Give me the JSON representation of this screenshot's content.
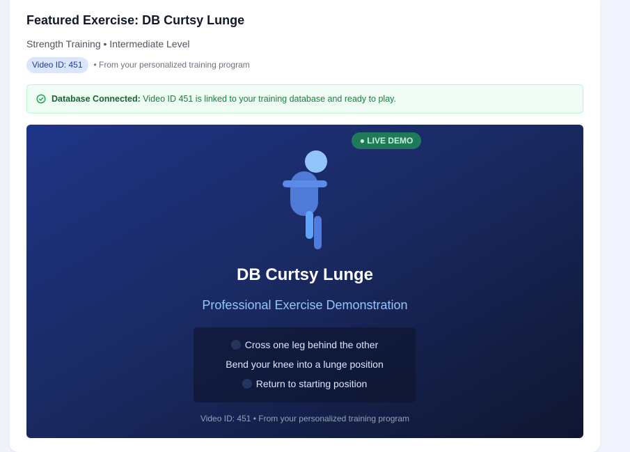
{
  "header": {
    "title": "Featured Exercise: DB Curtsy Lunge",
    "subtitle": "Strength Training • Intermediate Level",
    "video_badge": "Video ID: 451",
    "source_note": "• From your personalized training program"
  },
  "alert": {
    "icon": "check-circle-icon",
    "strong": "Database Connected:",
    "text": " Video ID 451 is linked to your training database and ready to play."
  },
  "player": {
    "live_badge": "● LIVE DEMO",
    "exercise_title": "DB Curtsy Lunge",
    "exercise_subtitle": "Professional Exercise Demonstration",
    "steps": [
      "Cross one leg behind the other",
      "Bend your knee into a lunge position",
      "Return to starting position"
    ],
    "footer": "Video ID: 451 • From your personalized training program"
  },
  "colors": {
    "accent": "#2563eb",
    "success": "#15803d",
    "player_bg": "#1a2a63",
    "live_badge": "#1f7a5a"
  }
}
